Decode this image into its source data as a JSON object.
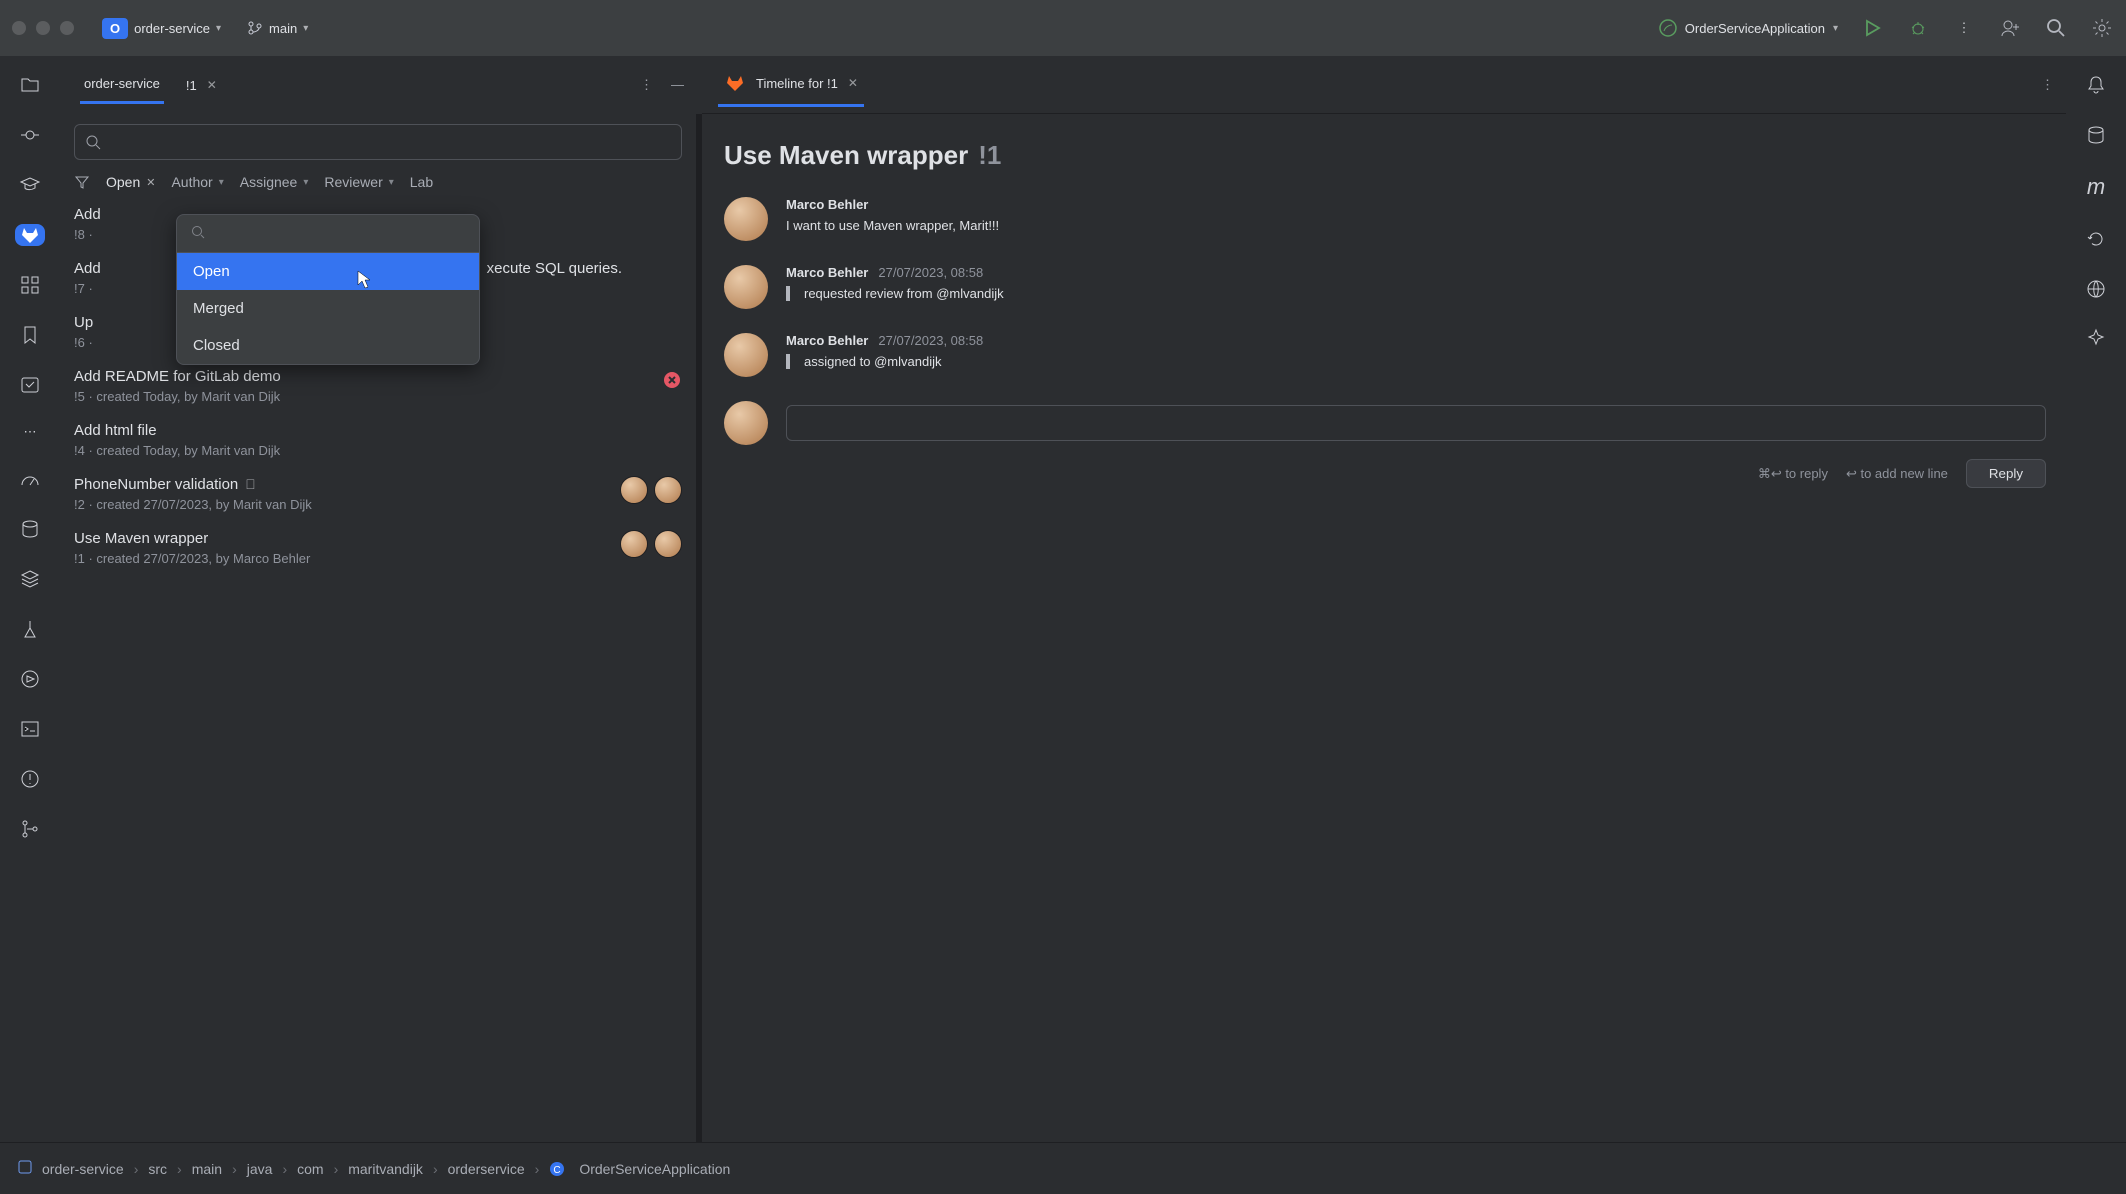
{
  "top": {
    "project_badge": "O",
    "project_name": "order-service",
    "branch": "main",
    "run_config": "OrderServiceApplication"
  },
  "panel_tabs": {
    "project": "order-service",
    "mr_tab": "!1"
  },
  "detail_tab": {
    "label": "Timeline for !1"
  },
  "filters": {
    "state": "Open",
    "author": "Author",
    "assignee": "Assignee",
    "reviewer": "Reviewer",
    "label": "Lab"
  },
  "dropdown": {
    "options": [
      "Open",
      "Merged",
      "Closed"
    ],
    "selected": "Open"
  },
  "mrs": [
    {
      "title": "Add",
      "meta": "!8 ·"
    },
    {
      "title": "Add",
      "meta": "!7 ·",
      "tail": "xecute SQL queries."
    },
    {
      "title": "Up",
      "meta": "!6 ·"
    },
    {
      "title": "Add README for GitLab demo",
      "meta": "!5 · created Today, by Marit van Dijk",
      "failed": true
    },
    {
      "title": "Add html file",
      "meta": "!4 · created Today, by Marit van Dijk"
    },
    {
      "title": "PhoneNumber validation",
      "meta": "!2 · created 27/07/2023, by Marit van Dijk",
      "tag": true,
      "avatars": 2
    },
    {
      "title": "Use Maven wrapper",
      "meta": "!1 · created 27/07/2023, by Marco Behler",
      "avatars": 2
    }
  ],
  "detail": {
    "title": "Use Maven wrapper",
    "mrno": "!1",
    "timeline": [
      {
        "author": "Marco Behler",
        "time": "",
        "text": "I want to use Maven wrapper, Marit!!!",
        "kind": "comment"
      },
      {
        "author": "Marco Behler",
        "time": "27/07/2023, 08:58",
        "text": "requested review from @mlvandijk",
        "kind": "system"
      },
      {
        "author": "Marco Behler",
        "time": "27/07/2023, 08:58",
        "text": "assigned to @mlvandijk",
        "kind": "system"
      }
    ],
    "reply_hint1": "⌘↩ to reply",
    "reply_hint2": "↩ to add new line",
    "reply_btn": "Reply"
  },
  "breadcrumb": [
    "order-service",
    "src",
    "main",
    "java",
    "com",
    "maritvandijk",
    "orderservice",
    "OrderServiceApplication"
  ]
}
